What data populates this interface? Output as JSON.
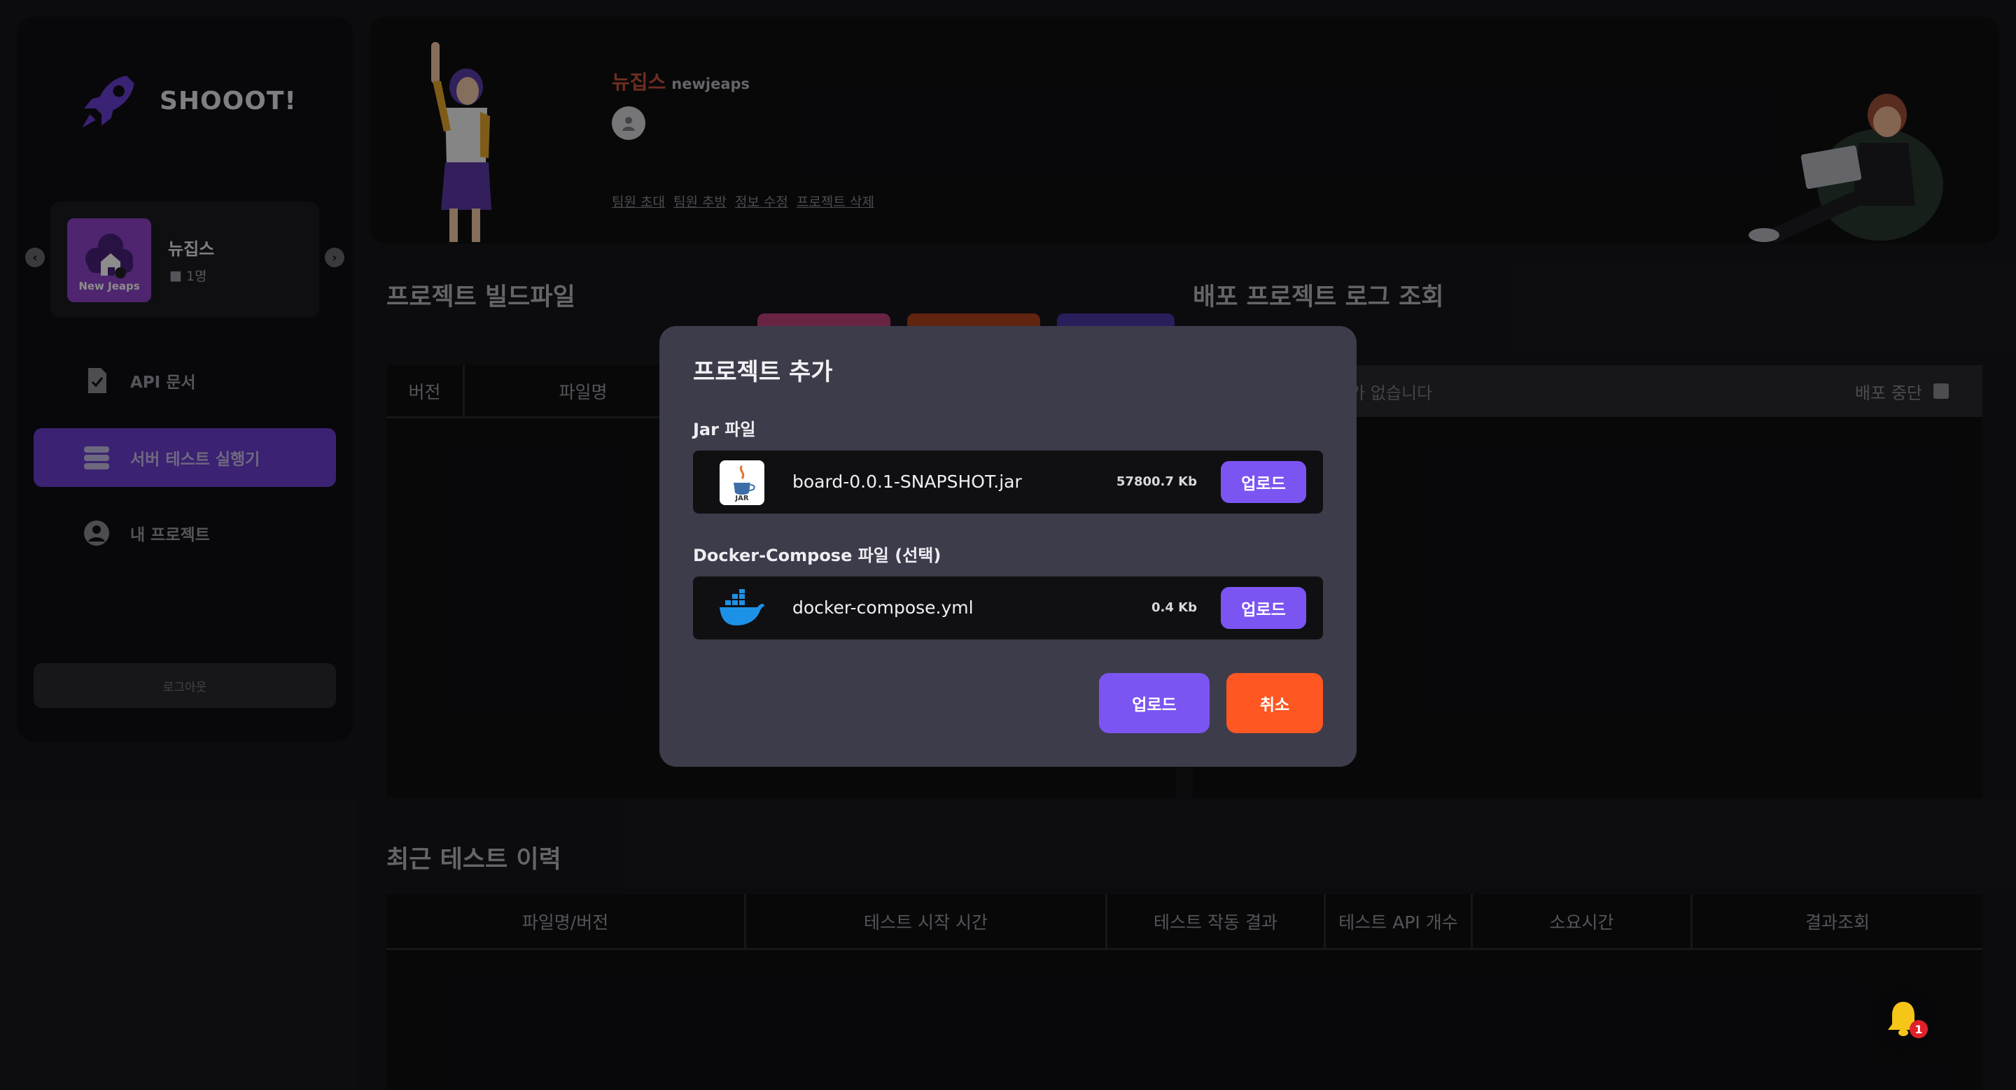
{
  "brand": {
    "name": "SHOOOT!"
  },
  "team": {
    "logo_text": "New Jeaps",
    "name": "뉴집스",
    "member_count": "1명"
  },
  "nav": {
    "items": [
      {
        "label": "API 문서"
      },
      {
        "label": "서버 테스트 실행기"
      },
      {
        "label": "내 프로젝트"
      }
    ],
    "logout": "로그아웃"
  },
  "header": {
    "team_name_kr": "뉴집스",
    "team_name_en": "newjeaps",
    "links": [
      "팀원 초대",
      "팀원 추방",
      "정보 수정",
      "프로젝트 삭제"
    ]
  },
  "build": {
    "title": "프로젝트 빌드파일",
    "columns": [
      "버전",
      "파일명"
    ]
  },
  "deploy": {
    "title": "배포 프로젝트 로그 조회",
    "empty_text": "로그가 없습니다",
    "stop_label": "배포 중단"
  },
  "history": {
    "title": "최근 테스트 이력",
    "columns": [
      "파일명/버전",
      "테스트 시작 시간",
      "테스트 작동 결과",
      "테스트 API 개수",
      "소요시간",
      "결과조회"
    ]
  },
  "modal": {
    "title": "프로젝트 추가",
    "jar": {
      "label": "Jar 파일",
      "file_name": "board-0.0.1-SNAPSHOT.jar",
      "size": "57800.7 Kb",
      "upload": "업로드",
      "icon_label": "JAR"
    },
    "compose": {
      "label": "Docker-Compose 파일 (선택)",
      "file_name": "docker-compose.yml",
      "size": "0.4 Kb",
      "upload": "업로드"
    },
    "confirm": "업로드",
    "cancel": "취소"
  },
  "notifications": {
    "count": "1"
  },
  "colors": {
    "accent": "#7b55f2",
    "cancel": "#ff5722",
    "active_nav": "#6c3fd0",
    "team_name": "#c8553d"
  }
}
